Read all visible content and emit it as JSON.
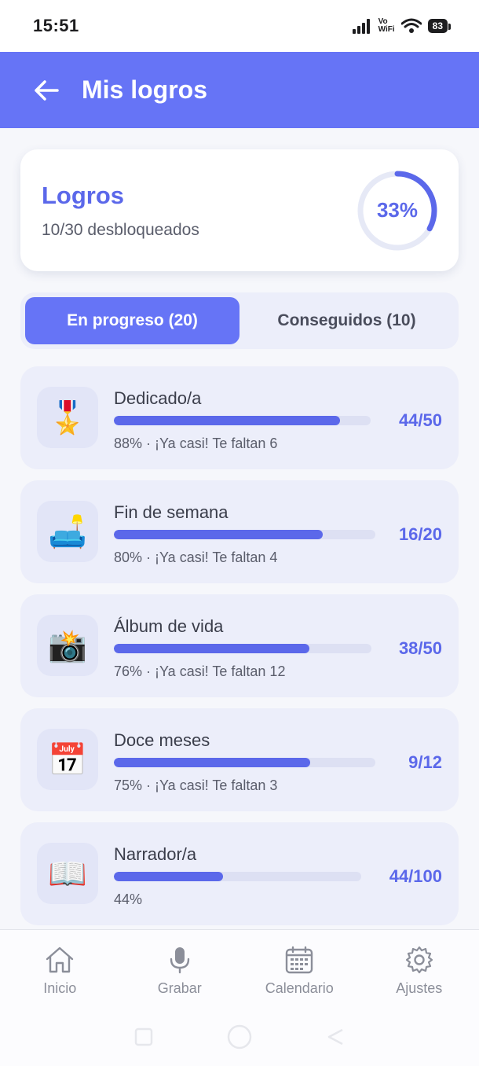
{
  "status": {
    "time": "15:51",
    "vowifi_top": "Vo",
    "vowifi_bottom": "WiFi",
    "battery": "83"
  },
  "header": {
    "title": "Mis logros"
  },
  "summary": {
    "title": "Logros",
    "subtitle": "10/30 desbloqueados",
    "percent_label": "33%",
    "percent": 0.33
  },
  "tabs": [
    {
      "label": "En progreso (20)",
      "active": true
    },
    {
      "label": "Conseguidos (10)",
      "active": false
    }
  ],
  "achievements": [
    {
      "icon": "medal-icon",
      "emoji": "🎖️",
      "name": "Dedicado/a",
      "progress": 0.88,
      "meta": "88% · ¡Ya casi! Te faltan 6",
      "count": "44/50"
    },
    {
      "icon": "couch-icon",
      "emoji": "🛋️",
      "name": "Fin de semana",
      "progress": 0.8,
      "meta": "80% · ¡Ya casi! Te faltan 4",
      "count": "16/20"
    },
    {
      "icon": "camera-icon",
      "emoji": "📸",
      "name": "Álbum de vida",
      "progress": 0.76,
      "meta": "76% · ¡Ya casi! Te faltan 12",
      "count": "38/50"
    },
    {
      "icon": "calendar-icon",
      "emoji": "📅",
      "name": "Doce meses",
      "progress": 0.75,
      "meta": "75% · ¡Ya casi! Te faltan 3",
      "count": "9/12"
    },
    {
      "icon": "book-icon",
      "emoji": "📖",
      "name": "Narrador/a",
      "progress": 0.44,
      "meta": "44%",
      "count": "44/100"
    }
  ],
  "nav": [
    {
      "icon": "home-icon",
      "label": "Inicio"
    },
    {
      "icon": "microphone-icon",
      "label": "Grabar"
    },
    {
      "icon": "calendar-icon",
      "label": "Calendario"
    },
    {
      "icon": "gear-icon",
      "label": "Ajustes"
    }
  ],
  "colors": {
    "primary": "#6674f6",
    "accent_text": "#5b68ea",
    "card_bg": "#eceefa"
  }
}
